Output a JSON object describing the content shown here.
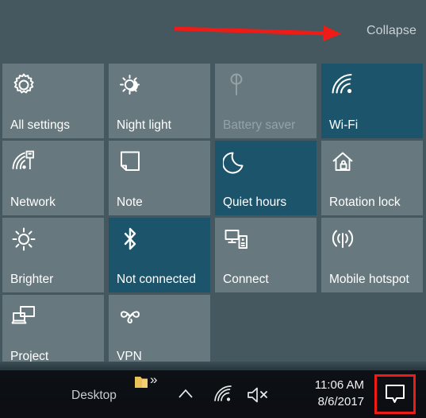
{
  "window": {
    "name": "Windows 10 Action Center",
    "panel_bg": "#45585f",
    "tile_bg": "#67797f",
    "tile_active_bg": "#1c556b",
    "disabled_text": "#95a2a6",
    "annotation_color": "#ef1b16"
  },
  "header": {
    "collapse_label": "Collapse"
  },
  "tiles": [
    {
      "label": "All settings",
      "icon": "gear-icon",
      "state": "off"
    },
    {
      "label": "Night light",
      "icon": "night-light-icon",
      "state": "off"
    },
    {
      "label": "Battery saver",
      "icon": "leaf-icon",
      "state": "disabled"
    },
    {
      "label": "Wi-Fi",
      "icon": "wifi-icon",
      "state": "on"
    },
    {
      "label": "Network",
      "icon": "network-icon",
      "state": "off"
    },
    {
      "label": "Note",
      "icon": "note-icon",
      "state": "off"
    },
    {
      "label": "Quiet hours",
      "icon": "moon-icon",
      "state": "on"
    },
    {
      "label": "Rotation lock",
      "icon": "rotation-lock-icon",
      "state": "off"
    },
    {
      "label": "Brighter",
      "icon": "brightness-icon",
      "state": "off"
    },
    {
      "label": "Not connected",
      "icon": "bluetooth-icon",
      "state": "on"
    },
    {
      "label": "Connect",
      "icon": "connect-icon",
      "state": "off"
    },
    {
      "label": "Mobile hotspot",
      "icon": "hotspot-icon",
      "state": "off"
    },
    {
      "label": "Project",
      "icon": "project-icon",
      "state": "off"
    },
    {
      "label": "VPN",
      "icon": "vpn-icon",
      "state": "off"
    }
  ],
  "taskbar": {
    "desktop_label": "Desktop",
    "folder_icon": "folder-icon",
    "overflow_chevrons": "»",
    "show_hidden_icon": "chevron-up-icon",
    "wifi_icon": "wifi-icon",
    "volume_icon": "volume-muted-icon",
    "clock_time": "11:06 AM",
    "clock_date": "8/6/2017",
    "action_center_icon": "action-center-icon"
  }
}
